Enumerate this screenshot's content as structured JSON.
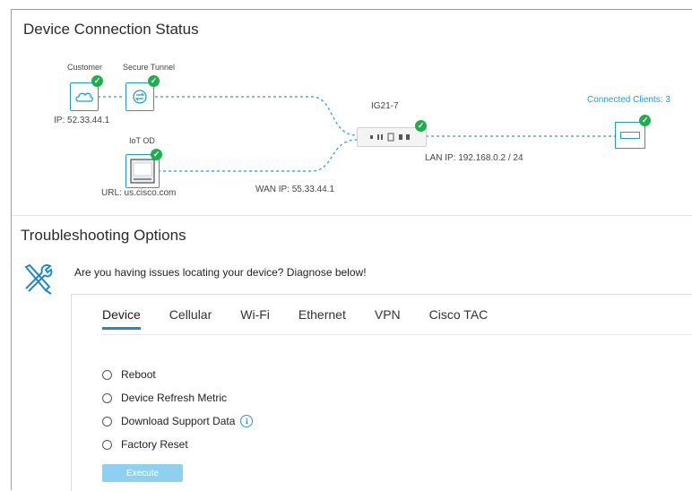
{
  "status": {
    "title": "Device Connection Status",
    "customer_label": "Customer",
    "customer_ip": "IP: 52.33.44.1",
    "tunnel_label": "Secure Tunnel",
    "iot_label": "IoT OD",
    "iot_url": "URL: us.cisco.com",
    "wan_ip": "WAN IP: 55.33.44.1",
    "router_name": "IG21-7",
    "lan_ip": "LAN IP: 192.168.0.2 / 24",
    "connected_clients": "Connected Clients: 3",
    "check_glyph": "✓"
  },
  "troubleshooting": {
    "title": "Troubleshooting Options",
    "question": "Are you having issues locating your device? Diagnose below!",
    "tabs": [
      {
        "label": "Device"
      },
      {
        "label": "Cellular"
      },
      {
        "label": "Wi-Fi"
      },
      {
        "label": "Ethernet"
      },
      {
        "label": "VPN"
      },
      {
        "label": "Cisco TAC"
      }
    ],
    "options": [
      {
        "label": "Reboot"
      },
      {
        "label": "Device Refresh Metric"
      },
      {
        "label": "Download Support Data"
      },
      {
        "label": "Factory Reset"
      }
    ],
    "info_glyph": "i",
    "execute_label": "Execute"
  },
  "colors": {
    "accent": "#1e9bd7",
    "success": "#1fae4b",
    "execute_disabled": "#8ed0ef"
  }
}
